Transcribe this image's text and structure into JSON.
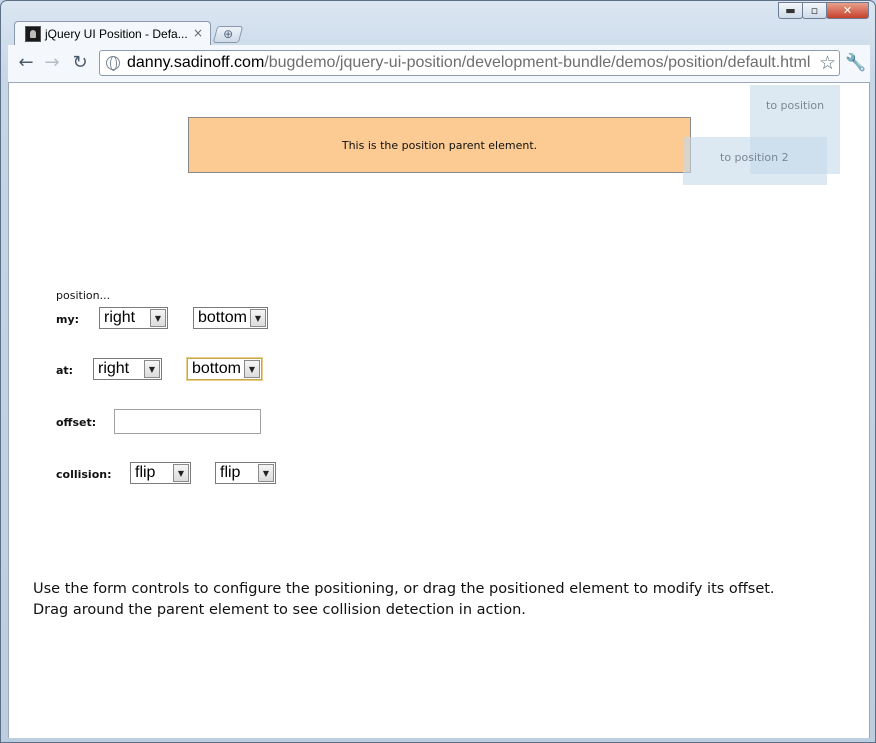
{
  "window": {
    "minimize_glyph": "▬",
    "maximize_glyph": "▫",
    "close_glyph": "✕"
  },
  "tab": {
    "title": "jQuery UI Position - Defa...",
    "close_glyph": "×",
    "new_tab_glyph": "⊕"
  },
  "toolbar": {
    "back_glyph": "←",
    "forward_glyph": "→",
    "reload_glyph": "↻",
    "url_host": "danny.sadinoff.com",
    "url_path": "/bugdemo/jquery-ui-position/development-bundle/demos/position/default.html",
    "star_glyph": "☆",
    "wrench_glyph": "🔧"
  },
  "page": {
    "parent_text": "This is the position parent element.",
    "positionable1": "to position",
    "positionable2": "to position 2",
    "form": {
      "heading": "position...",
      "my_label": "my:",
      "my_horizontal": "right",
      "my_vertical": "bottom",
      "at_label": "at:",
      "at_horizontal": "right",
      "at_vertical": "bottom",
      "offset_label": "offset:",
      "offset_value": "",
      "collision_label": "collision:",
      "collision_horizontal": "flip",
      "collision_vertical": "flip",
      "arrow_glyph": "▼"
    },
    "description_line1": "Use the form controls to configure the positioning, or drag the positioned element to modify its offset.",
    "description_line2": "Drag around the parent element to see collision detection in action."
  }
}
